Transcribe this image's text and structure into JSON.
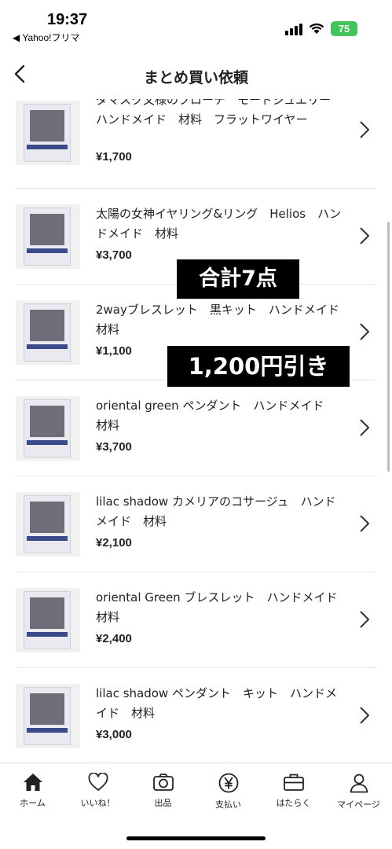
{
  "status": {
    "time": "19:37",
    "back_app": "◀ Yahoo!フリマ",
    "battery": "75"
  },
  "nav": {
    "title": "まとめ買い依頼"
  },
  "items": [
    {
      "title": "ダマスク文様のブローチ　モードジュエリー　ハンドメイド　材料　フラットワイヤー",
      "price": "¥1,700"
    },
    {
      "title": "太陽の女神イヤリング&リング　Helios　ハンドメイド　材料",
      "price": "¥3,700"
    },
    {
      "title": "2wayブレスレット　黒キット　ハンドメイド　材料",
      "price": "¥1,100"
    },
    {
      "title": "oriental green ペンダント　ハンドメイド　材料",
      "price": "¥3,700"
    },
    {
      "title": "lilac shadow カメリアのコサージュ　ハンドメイド　材料",
      "price": "¥2,100"
    },
    {
      "title": "oriental Green ブレスレット　ハンドメイド　材料",
      "price": "¥2,400"
    },
    {
      "title": "lilac shadow ペンダント　キット　ハンドメイド　材料",
      "price": "¥3,000"
    }
  ],
  "overlays": {
    "count": "合計7点",
    "discount": "1,200円引き"
  },
  "tabs": [
    {
      "label": "ホーム",
      "icon": "home-icon"
    },
    {
      "label": "いいね！",
      "icon": "heart-icon"
    },
    {
      "label": "出品",
      "icon": "camera-icon"
    },
    {
      "label": "支払い",
      "icon": "yen-icon"
    },
    {
      "label": "はたらく",
      "icon": "briefcase-icon"
    },
    {
      "label": "マイページ",
      "icon": "person-icon"
    }
  ]
}
